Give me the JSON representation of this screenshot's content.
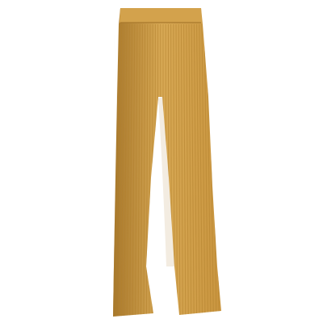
{
  "image": {
    "subject": "corduroy-flare-trousers-icon",
    "colors": {
      "background": "#ffffff",
      "fabric": "#c9953f",
      "fabric_light": "#d8a955",
      "fabric_dark": "#a8782c",
      "rib": "#b3822f",
      "waistband": "#d3a24c"
    }
  }
}
